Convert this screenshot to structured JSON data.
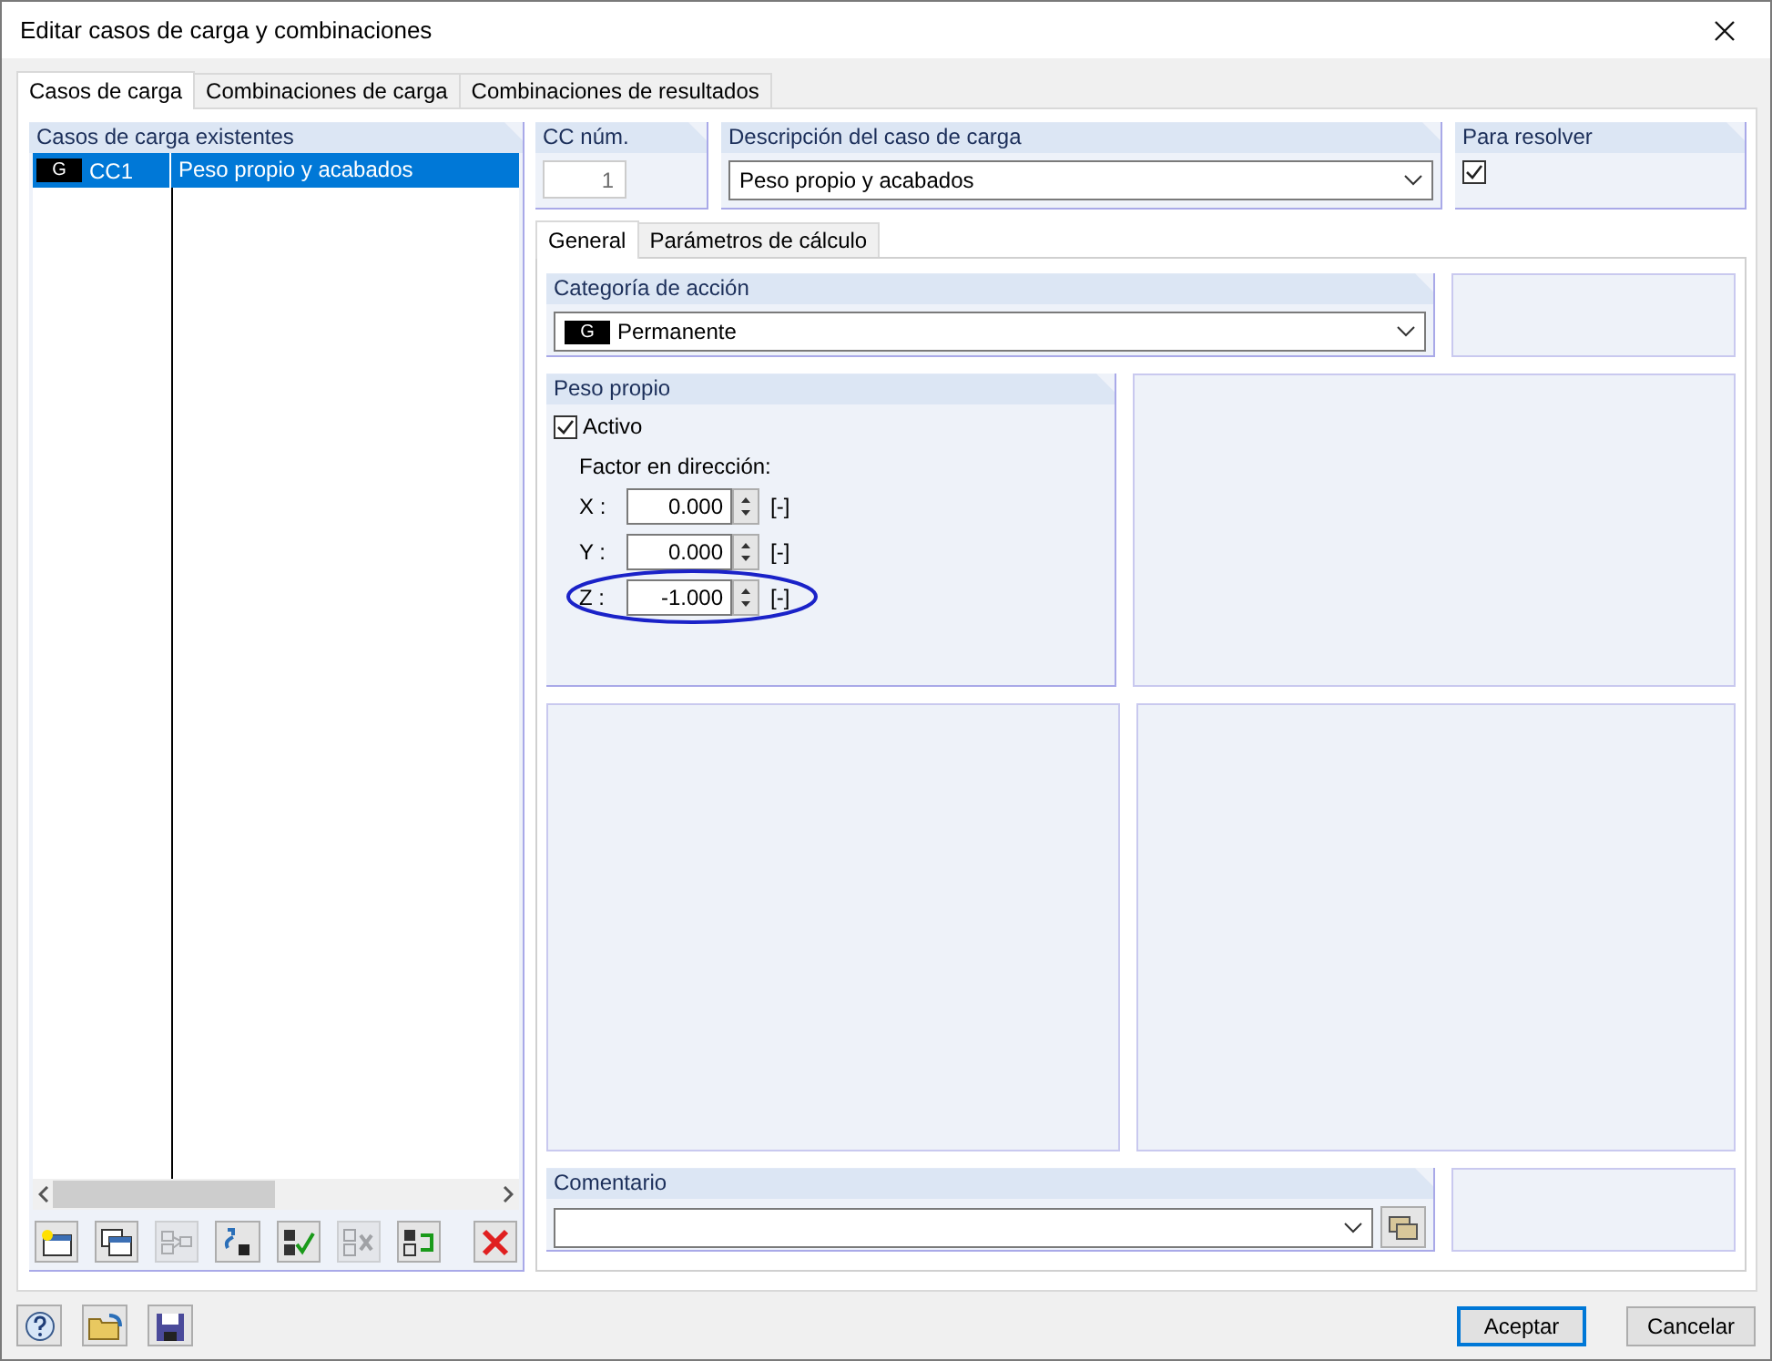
{
  "window": {
    "title": "Editar casos de carga y combinaciones"
  },
  "tabs": [
    {
      "label": "Casos de carga",
      "selected": true
    },
    {
      "label": "Combinaciones de carga",
      "selected": false
    },
    {
      "label": "Combinaciones de resultados",
      "selected": false
    }
  ],
  "load_case_list": {
    "title": "Casos de carga existentes",
    "rows": [
      {
        "category": "G",
        "id": "CC1",
        "description": "Peso propio y acabados",
        "selected": true
      }
    ]
  },
  "list_toolbar": [
    {
      "kind": "new",
      "disabled": false
    },
    {
      "kind": "copy",
      "disabled": false
    },
    {
      "kind": "renumber",
      "disabled": true
    },
    {
      "kind": "sort",
      "disabled": false
    },
    {
      "kind": "check-all",
      "disabled": false
    },
    {
      "kind": "uncheck-all",
      "disabled": true
    },
    {
      "kind": "toggle",
      "disabled": false
    },
    {
      "kind": "delete",
      "disabled": false
    }
  ],
  "cc_number": {
    "label": "CC núm.",
    "value": "1"
  },
  "description": {
    "label": "Descripción del caso de carga",
    "value": "Peso propio y acabados"
  },
  "to_solve": {
    "label": "Para resolver",
    "checked": true
  },
  "inner_tabs": [
    {
      "label": "General",
      "selected": true
    },
    {
      "label": "Parámetros de cálculo",
      "selected": false
    }
  ],
  "action_category": {
    "label": "Categoría de acción",
    "badge": "G",
    "value": "Permanente"
  },
  "self_weight": {
    "title": "Peso propio",
    "active": {
      "label": "Activo",
      "checked": true
    },
    "factor_label": "Factor en dirección:",
    "factors": [
      {
        "axis": "X :",
        "value": "0.000",
        "unit": "[-]",
        "highlighted": false
      },
      {
        "axis": "Y :",
        "value": "0.000",
        "unit": "[-]",
        "highlighted": false
      },
      {
        "axis": "Z :",
        "value": "-1.000",
        "unit": "[-]",
        "highlighted": true
      }
    ]
  },
  "comment": {
    "label": "Comentario"
  },
  "footer_tools": [
    {
      "kind": "help"
    },
    {
      "kind": "open"
    },
    {
      "kind": "save"
    }
  ],
  "buttons": [
    {
      "label": "Aceptar",
      "default": true
    },
    {
      "label": "Cancelar",
      "default": false
    }
  ]
}
